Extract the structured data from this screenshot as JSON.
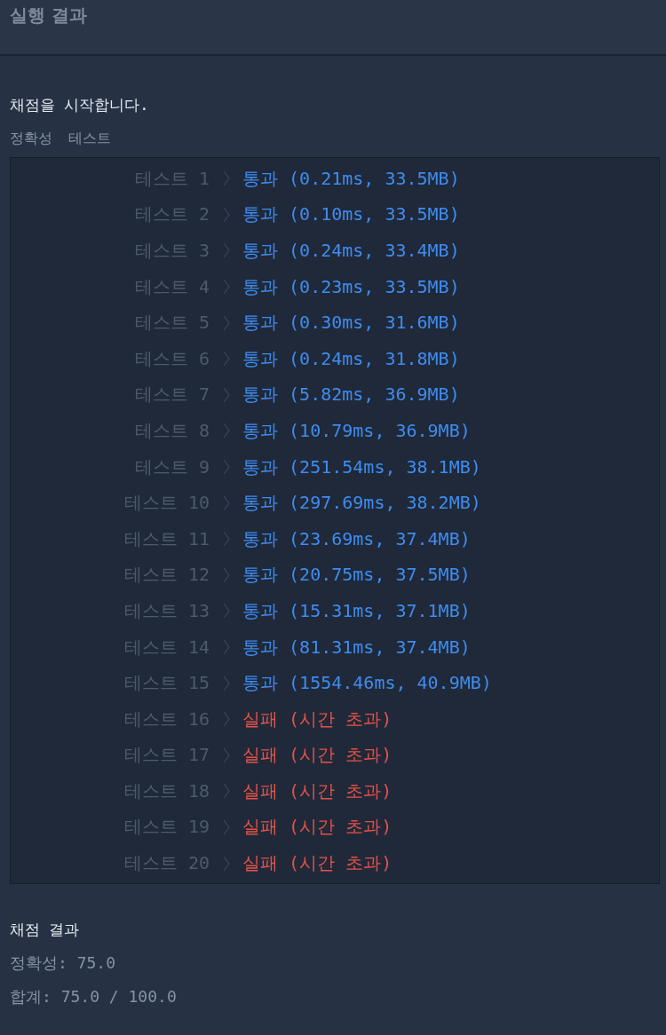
{
  "title": "실행 결과",
  "start_message": "채점을 시작합니다.",
  "section_labels": [
    "정확성",
    "테스트"
  ],
  "tests": [
    {
      "label": "테스트 1",
      "kind": "pass",
      "verdict": "통과",
      "detail": "(0.21ms, 33.5MB)"
    },
    {
      "label": "테스트 2",
      "kind": "pass",
      "verdict": "통과",
      "detail": "(0.10ms, 33.5MB)"
    },
    {
      "label": "테스트 3",
      "kind": "pass",
      "verdict": "통과",
      "detail": "(0.24ms, 33.4MB)"
    },
    {
      "label": "테스트 4",
      "kind": "pass",
      "verdict": "통과",
      "detail": "(0.23ms, 33.5MB)"
    },
    {
      "label": "테스트 5",
      "kind": "pass",
      "verdict": "통과",
      "detail": "(0.30ms, 31.6MB)"
    },
    {
      "label": "테스트 6",
      "kind": "pass",
      "verdict": "통과",
      "detail": "(0.24ms, 31.8MB)"
    },
    {
      "label": "테스트 7",
      "kind": "pass",
      "verdict": "통과",
      "detail": "(5.82ms, 36.9MB)"
    },
    {
      "label": "테스트 8",
      "kind": "pass",
      "verdict": "통과",
      "detail": "(10.79ms, 36.9MB)"
    },
    {
      "label": "테스트 9",
      "kind": "pass",
      "verdict": "통과",
      "detail": "(251.54ms, 38.1MB)"
    },
    {
      "label": "테스트 10",
      "kind": "pass",
      "verdict": "통과",
      "detail": "(297.69ms, 38.2MB)"
    },
    {
      "label": "테스트 11",
      "kind": "pass",
      "verdict": "통과",
      "detail": "(23.69ms, 37.4MB)"
    },
    {
      "label": "테스트 12",
      "kind": "pass",
      "verdict": "통과",
      "detail": "(20.75ms, 37.5MB)"
    },
    {
      "label": "테스트 13",
      "kind": "pass",
      "verdict": "통과",
      "detail": "(15.31ms, 37.1MB)"
    },
    {
      "label": "테스트 14",
      "kind": "pass",
      "verdict": "통과",
      "detail": "(81.31ms, 37.4MB)"
    },
    {
      "label": "테스트 15",
      "kind": "pass",
      "verdict": "통과",
      "detail": "(1554.46ms, 40.9MB)"
    },
    {
      "label": "테스트 16",
      "kind": "fail",
      "verdict": "실패",
      "detail": "(시간 초과)"
    },
    {
      "label": "테스트 17",
      "kind": "fail",
      "verdict": "실패",
      "detail": "(시간 초과)"
    },
    {
      "label": "테스트 18",
      "kind": "fail",
      "verdict": "실패",
      "detail": "(시간 초과)"
    },
    {
      "label": "테스트 19",
      "kind": "fail",
      "verdict": "실패",
      "detail": "(시간 초과)"
    },
    {
      "label": "테스트 20",
      "kind": "fail",
      "verdict": "실패",
      "detail": "(시간 초과)"
    }
  ],
  "summary": {
    "heading": "채점 결과",
    "lines": [
      "정확성: 75.0",
      "합계: 75.0 / 100.0"
    ]
  }
}
